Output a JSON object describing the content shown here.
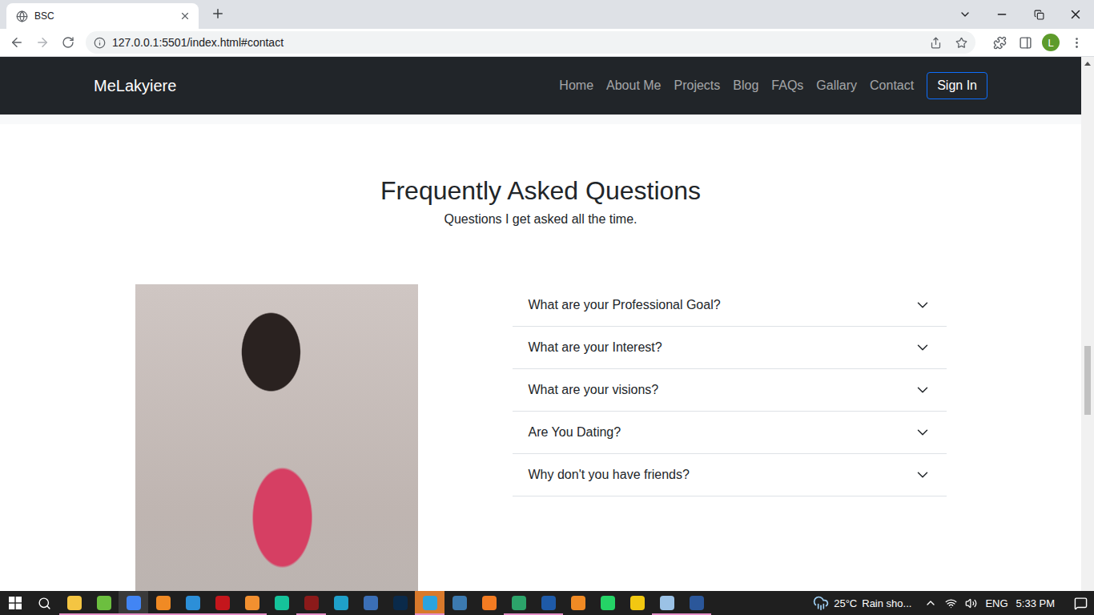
{
  "browser": {
    "tabs": [
      {
        "label": "BSC",
        "selected": true
      }
    ],
    "address": "127.0.0.1:5501/index.html#contact",
    "profile": "L"
  },
  "navbar": {
    "brand": "MeLakyiere",
    "links": [
      {
        "label": "Home",
        "selected": false
      },
      {
        "label": "About Me",
        "selected": false
      },
      {
        "label": "Projects",
        "selected": false
      },
      {
        "label": "Blog",
        "selected": false
      },
      {
        "label": "FAQs",
        "selected": false
      },
      {
        "label": "Gallary",
        "selected": false
      },
      {
        "label": "Contact",
        "selected": false
      }
    ],
    "button": "Sign In"
  },
  "faq": {
    "title": "Frequently Asked Questions",
    "subtitle": "Questions I get asked all the time.",
    "items": [
      {
        "question": "What are your Professional Goal?",
        "expanded": false
      },
      {
        "question": "What are your Interest?",
        "expanded": false
      },
      {
        "question": "What are your visions?",
        "expanded": false
      },
      {
        "question": "Are You Dating?",
        "expanded": false
      },
      {
        "question": "Why don't you have friends?",
        "expanded": false
      }
    ]
  },
  "taskbar": {
    "apps": [
      {
        "color": "#f4c542",
        "running": true,
        "selected": false,
        "flashing": false
      },
      {
        "color": "#6cbf3f",
        "running": true,
        "selected": false,
        "flashing": false
      },
      {
        "color": "#4285f4",
        "running": true,
        "selected": true,
        "flashing": false
      },
      {
        "color": "#f08a24",
        "running": true,
        "selected": false,
        "flashing": false
      },
      {
        "color": "#2c8fd8",
        "running": true,
        "selected": false,
        "flashing": false
      },
      {
        "color": "#c4161c",
        "running": true,
        "selected": false,
        "flashing": false
      },
      {
        "color": "#f29030",
        "running": true,
        "selected": false,
        "flashing": false
      },
      {
        "color": "#15c39a",
        "running": false,
        "selected": false,
        "flashing": false
      },
      {
        "color": "#8b1a1a",
        "running": true,
        "selected": false,
        "flashing": false
      },
      {
        "color": "#1fa0c9",
        "running": false,
        "selected": false,
        "flashing": false
      },
      {
        "color": "#3b6fb6",
        "running": false,
        "selected": false,
        "flashing": false
      },
      {
        "color": "#0a2a4a",
        "running": false,
        "selected": false,
        "flashing": false
      },
      {
        "color": "#2aa3df",
        "running": true,
        "selected": false,
        "flashing": true
      },
      {
        "color": "#3c7ab0",
        "running": false,
        "selected": false,
        "flashing": false
      },
      {
        "color": "#f27b22",
        "running": false,
        "selected": false,
        "flashing": false
      },
      {
        "color": "#2ca36a",
        "running": true,
        "selected": false,
        "flashing": false
      },
      {
        "color": "#1e5aa8",
        "running": true,
        "selected": false,
        "flashing": false
      },
      {
        "color": "#f08a24",
        "running": false,
        "selected": false,
        "flashing": false
      },
      {
        "color": "#25d366",
        "running": false,
        "selected": false,
        "flashing": false
      },
      {
        "color": "#f2c811",
        "running": false,
        "selected": false,
        "flashing": false
      },
      {
        "color": "#9bc2e6",
        "running": true,
        "selected": false,
        "flashing": false
      },
      {
        "color": "#2b579a",
        "running": true,
        "selected": false,
        "flashing": false
      }
    ],
    "weather": {
      "temperature": "25°C",
      "condition": "Rain sho..."
    },
    "language": "ENG",
    "time": "5:33 PM"
  }
}
